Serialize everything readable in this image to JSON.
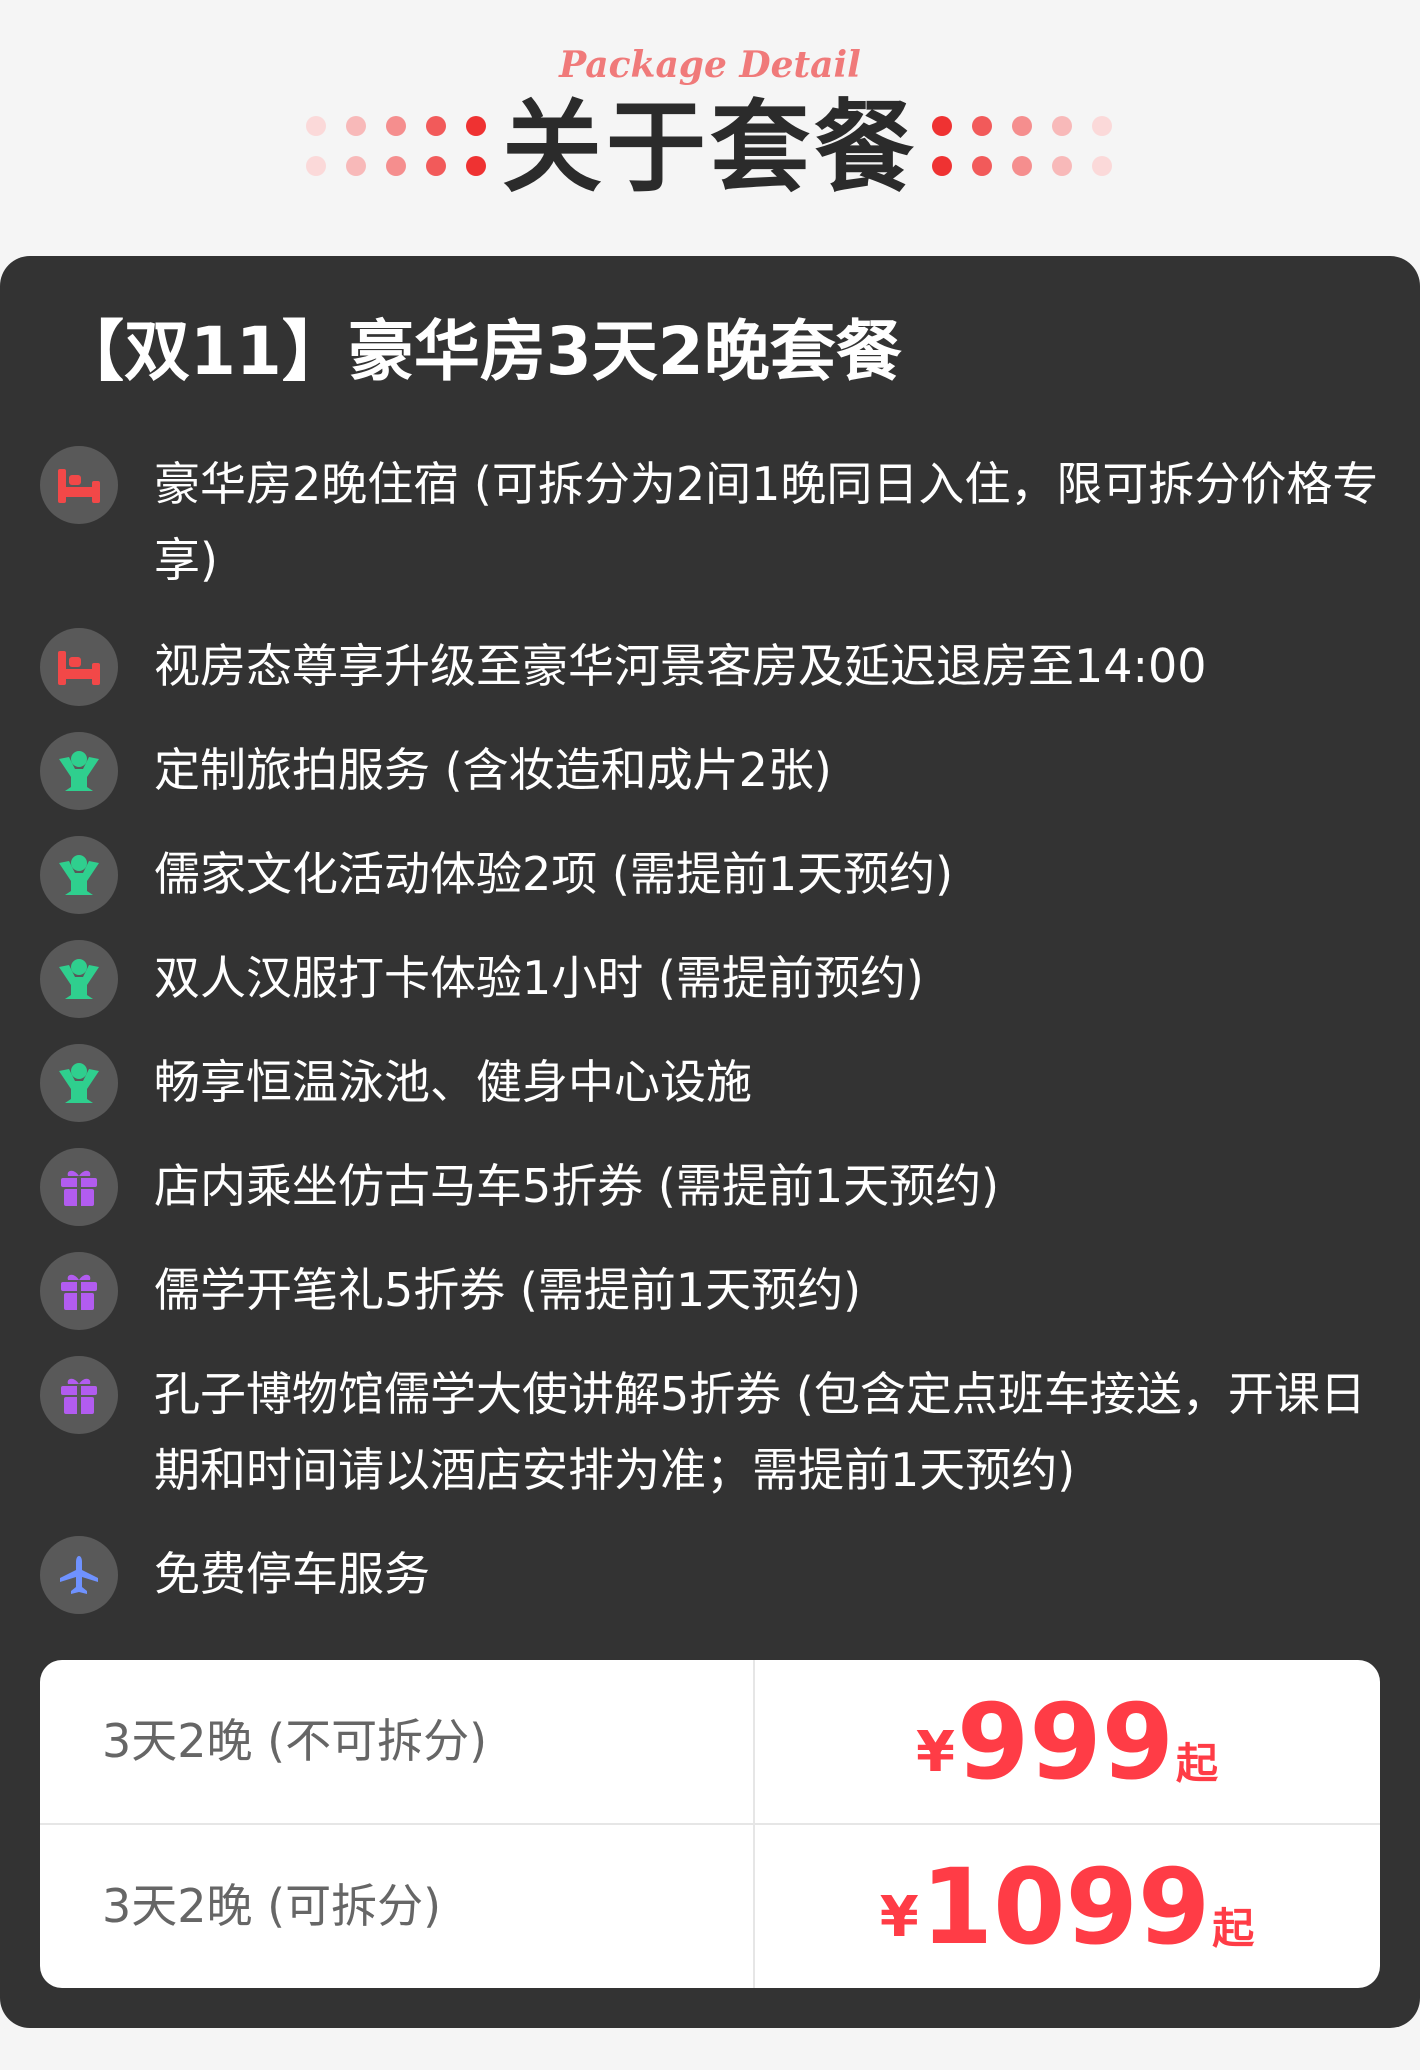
{
  "header": {
    "subtitle": "Package Detail",
    "title": "关于套餐",
    "dot_colors_light_to_dark": [
      "#fbd9d9",
      "#f8b9b9",
      "#f58e8e",
      "#f25a5a",
      "#ef3232"
    ]
  },
  "package": {
    "title": "【双11】豪华房3天2晚套餐",
    "items": [
      {
        "icon": "bed-icon",
        "text": "豪华房2晚住宿 (可拆分为2间1晚同日入住，限可拆分价格专享)"
      },
      {
        "icon": "bed-icon",
        "text": "视房态尊享升级至豪华河景客房及延迟退房至14:00"
      },
      {
        "icon": "person-icon",
        "text": "定制旅拍服务 (含妆造和成片2张)"
      },
      {
        "icon": "person-icon",
        "text": "儒家文化活动体验2项 (需提前1天预约)"
      },
      {
        "icon": "person-icon",
        "text": "双人汉服打卡体验1小时 (需提前预约)"
      },
      {
        "icon": "person-icon",
        "text": "畅享恒温泳池、健身中心设施"
      },
      {
        "icon": "gift-icon",
        "text": "店内乘坐仿古马车5折券 (需提前1天预约)"
      },
      {
        "icon": "gift-icon",
        "text": "儒学开笔礼5折券 (需提前1天预约)"
      },
      {
        "icon": "gift-icon",
        "text": "孔子博物馆儒学大使讲解5折券 (包含定点班车接送，开课日期和时间请以酒店安排为准；需提前1天预约)"
      },
      {
        "icon": "plane-icon",
        "text": "免费停车服务"
      }
    ]
  },
  "prices": [
    {
      "label": "3天2晚 (不可拆分)",
      "currency": "¥",
      "amount": "999",
      "suffix": "起"
    },
    {
      "label": "3天2晚 (可拆分)",
      "currency": "¥",
      "amount": "1099",
      "suffix": "起"
    }
  ],
  "colors": {
    "card_bg": "#333333",
    "accent_red": "#ff3c46",
    "icon_bed": "#f24848",
    "icon_person": "#2fcf8e",
    "icon_gift": "#b25cf0",
    "icon_plane": "#6f92ff"
  }
}
